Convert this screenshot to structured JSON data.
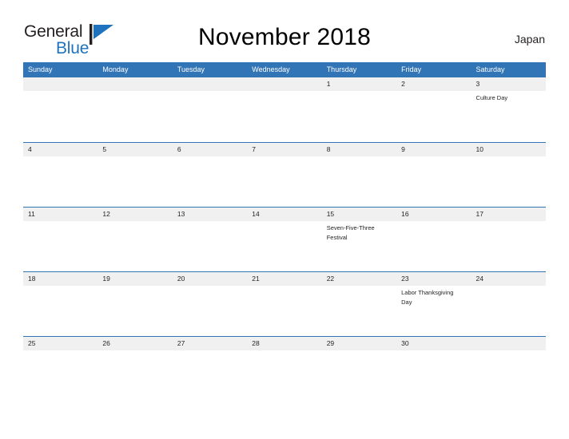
{
  "brand": {
    "word_one": "General",
    "word_two": "Blue",
    "mark_name": "general-blue-flag-logo",
    "color_dark": "#231f20",
    "color_blue": "#1f72bd"
  },
  "header": {
    "title": "November 2018",
    "country": "Japan"
  },
  "theme": {
    "header_blue": "#3275b6",
    "date_band_gray": "#f0f0f0",
    "text_dark": "#231f20",
    "page_background": "#ffffff"
  },
  "calendar": {
    "weekdays": [
      "Sunday",
      "Monday",
      "Tuesday",
      "Wednesday",
      "Thursday",
      "Friday",
      "Saturday"
    ],
    "weeks": [
      {
        "days": [
          {
            "date": "",
            "events": []
          },
          {
            "date": "",
            "events": []
          },
          {
            "date": "",
            "events": []
          },
          {
            "date": "",
            "events": []
          },
          {
            "date": "1",
            "events": []
          },
          {
            "date": "2",
            "events": []
          },
          {
            "date": "3",
            "events": [
              "Culture Day"
            ]
          }
        ]
      },
      {
        "days": [
          {
            "date": "4",
            "events": []
          },
          {
            "date": "5",
            "events": []
          },
          {
            "date": "6",
            "events": []
          },
          {
            "date": "7",
            "events": []
          },
          {
            "date": "8",
            "events": []
          },
          {
            "date": "9",
            "events": []
          },
          {
            "date": "10",
            "events": []
          }
        ]
      },
      {
        "days": [
          {
            "date": "11",
            "events": []
          },
          {
            "date": "12",
            "events": []
          },
          {
            "date": "13",
            "events": []
          },
          {
            "date": "14",
            "events": []
          },
          {
            "date": "15",
            "events": [
              "Seven-Five-Three Festival"
            ]
          },
          {
            "date": "16",
            "events": []
          },
          {
            "date": "17",
            "events": []
          }
        ]
      },
      {
        "days": [
          {
            "date": "18",
            "events": []
          },
          {
            "date": "19",
            "events": []
          },
          {
            "date": "20",
            "events": []
          },
          {
            "date": "21",
            "events": []
          },
          {
            "date": "22",
            "events": []
          },
          {
            "date": "23",
            "events": [
              "Labor Thanksgiving Day"
            ]
          },
          {
            "date": "24",
            "events": []
          }
        ]
      },
      {
        "days": [
          {
            "date": "25",
            "events": []
          },
          {
            "date": "26",
            "events": []
          },
          {
            "date": "27",
            "events": []
          },
          {
            "date": "28",
            "events": []
          },
          {
            "date": "29",
            "events": []
          },
          {
            "date": "30",
            "events": []
          },
          {
            "date": "",
            "events": []
          }
        ]
      }
    ]
  }
}
